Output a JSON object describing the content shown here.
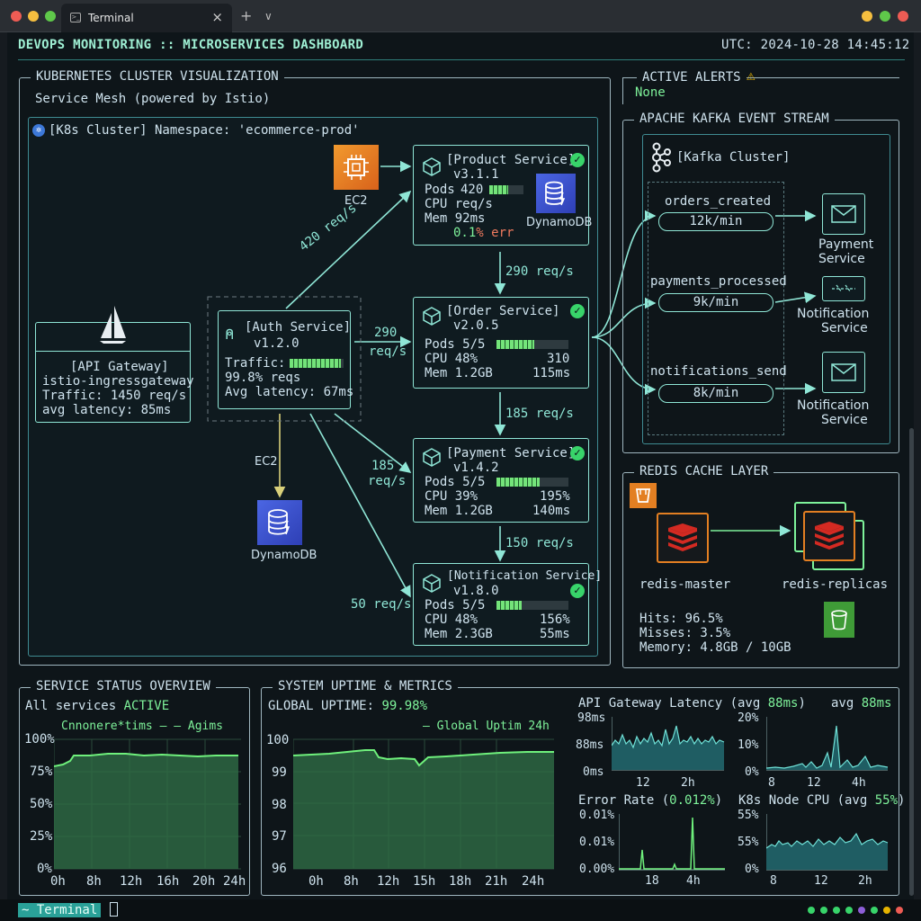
{
  "window": {
    "tab_title": "Terminal"
  },
  "header": {
    "title": "DEVOPS MONITORING :: MICROSERVICES DASHBOARD",
    "utc": "UTC: 2024-10-28 14:45:12"
  },
  "cluster": {
    "title": "KUBERNETES CLUSTER VISUALIZATION",
    "subtitle": "Service Mesh (powered by Istio)",
    "namespace": "[K8s Cluster] Namespace: 'ecommerce-prod'",
    "api_gateway": {
      "label": "[API Gateway]",
      "name": "istio-ingressgateway",
      "traffic": "Traffic: 1450 req/s",
      "latency": "avg latency: 85ms"
    },
    "auth": {
      "label": "[Auth Service]",
      "version": "v1.2.0",
      "traffic_label": "Traffic:",
      "traffic_level": 0.95,
      "reqs": "99.8% reqs",
      "latency": "Avg latency: 67ms"
    },
    "product": {
      "label": "[Product Service]",
      "version": "v3.1.1",
      "pods_label": "Pods",
      "pods": "420",
      "pods_level": 0.55,
      "cpu": "CPU  req/s",
      "mem": "Mem 92ms",
      "err_prefix": "0.1",
      "err_suffix": "% err",
      "db": "DynamoDB"
    },
    "order": {
      "label": "[Order Service]",
      "version": "v2.0.5",
      "pods_label": "Pods 5/5",
      "pods_level": 0.52,
      "cpu": "CPU  48%",
      "cpu_val": "310",
      "mem": "Mem 1.2GB",
      "mem_val": "115ms"
    },
    "payment": {
      "label": "[Payment Service]",
      "version": "v1.4.2",
      "pods_label": "Pods 5/5",
      "pods_level": 0.6,
      "cpu": "CPU  39%",
      "cpu_val": "195%",
      "mem": "Mem 1.2GB",
      "mem_val": "140ms"
    },
    "notification": {
      "label": "[Notification Service]",
      "version": "v1.8.0",
      "pods_label": "Pods 5/5",
      "pods_level": 0.35,
      "cpu": "CPU  48%",
      "cpu_val": "156%",
      "mem": "Mem 2.3GB",
      "mem_val": "55ms"
    },
    "ec2_top": "EC2",
    "ec2_auth": "EC2",
    "dynamo_auth": "DynamoDB",
    "edges": {
      "gw_product": "420 req/s",
      "auth_order_a": "290",
      "auth_order_b": "req/s",
      "product_order": "290 req/s",
      "order_payment": "185 req/s",
      "auth_payment_a": "185",
      "auth_payment_b": "req/s",
      "payment_notif": "150 req/s",
      "auth_notif": "50 req/s"
    }
  },
  "alerts": {
    "title": "ACTIVE ALERTS",
    "value": "None"
  },
  "kafka": {
    "title": "APACHE KAFKA EVENT STREAM",
    "cluster": "[Kafka Cluster]",
    "topics": [
      {
        "name": "orders_created",
        "rate": "12k/min",
        "consumer_a": "Payment",
        "consumer_b": "Service"
      },
      {
        "name": "payments_processed",
        "rate": "9k/min",
        "consumer_a": "Notification",
        "consumer_b": "Service"
      },
      {
        "name": "notifications_send",
        "rate": "8k/min",
        "consumer_a": "Notification",
        "consumer_b": "Service"
      }
    ]
  },
  "redis": {
    "title": "REDIS CACHE LAYER",
    "master": "redis-master",
    "replicas": "redis-replicas",
    "hits": "Hits: 96.5%",
    "misses": "Misses: 3.5%",
    "memory": "Memory: 4.8GB / 10GB"
  },
  "status_overview": {
    "title": "SERVICE STATUS OVERVIEW",
    "line_prefix": "All services",
    "line_value": "ACTIVE",
    "legend": "Cnnonere*tims — — Agims",
    "yticks": [
      "100%",
      "75%",
      "50%",
      "25%",
      "0%"
    ],
    "xticks": [
      "0h",
      "8h",
      "12h",
      "16h",
      "20h",
      "24h"
    ]
  },
  "uptime": {
    "title": "SYSTEM UPTIME & METRICS",
    "global_label": "GLOBAL UPTIME:",
    "global_value": "99.98%",
    "legend": "— Global Uptim 24h",
    "yticks": [
      "100",
      "99",
      "98",
      "97",
      "96"
    ],
    "xticks": [
      "0h",
      "8h",
      "12h",
      "15h",
      "18h",
      "21h",
      "24h"
    ]
  },
  "mini": {
    "latency": {
      "title_a": "API Gateway Latency (avg ",
      "title_b": "88ms",
      "title_c": ")",
      "avg_a": "avg ",
      "avg_b": "88ms",
      "yticks": [
        "98ms",
        "88ms",
        "0ms"
      ],
      "xticks": [
        "12",
        "2h"
      ]
    },
    "errors_top": {
      "yticks": [
        "20%",
        "10%",
        "0%"
      ],
      "xticks": [
        "8",
        "12",
        "4h"
      ]
    },
    "error_rate": {
      "title_a": "Error Rate (",
      "title_b": "0.012%",
      "title_c": ")",
      "yticks": [
        "0.01%",
        "0.01%",
        "0.00%"
      ],
      "xticks": [
        "18",
        "4h"
      ]
    },
    "node_cpu": {
      "title_a": "K8s Node CPU (avg ",
      "title_b": "55%",
      "title_c": ")",
      "yticks": [
        "55%",
        "55%",
        "0%"
      ],
      "xticks": [
        "8",
        "12",
        "2h"
      ]
    }
  },
  "statusbar": {
    "prompt": "~ Terminal"
  },
  "colors": {
    "accent": "#8fe6d6",
    "ok": "#38d46a",
    "warn": "#e7b400",
    "bar": "#74e47a"
  }
}
